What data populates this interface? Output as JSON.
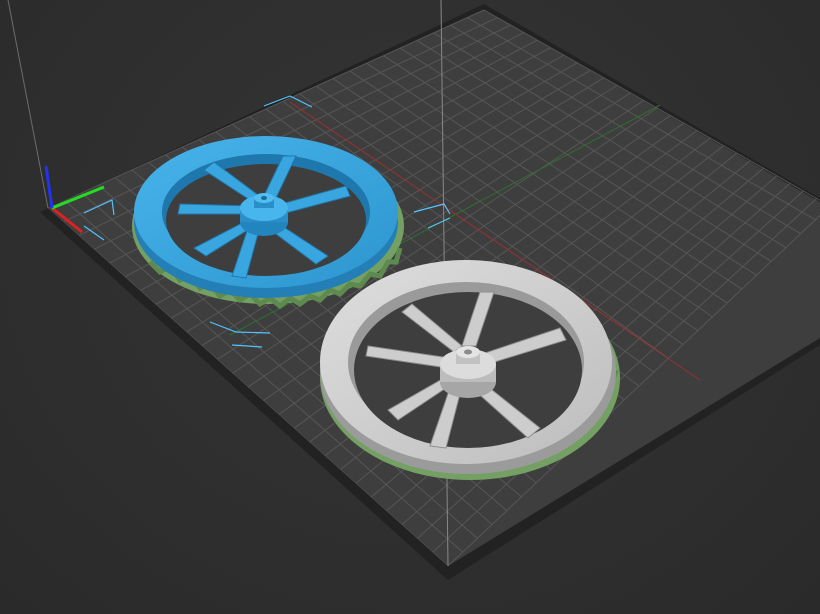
{
  "viewport": {
    "background_color": "#2f2f2f",
    "bed_color": "#3f3f3f",
    "bed_border_color": "#232323",
    "grid_color": "#555555"
  },
  "axes": {
    "x_color": "#e02020",
    "y_color": "#22dd22",
    "z_color": "#2233ee"
  },
  "objects": [
    {
      "state": "selected",
      "color": "#2e9fd8",
      "kind": "wheel-model"
    },
    {
      "state": "unselected",
      "color": "#c8c8c8",
      "kind": "wheel-model"
    }
  ],
  "support_color": "#7da66a"
}
